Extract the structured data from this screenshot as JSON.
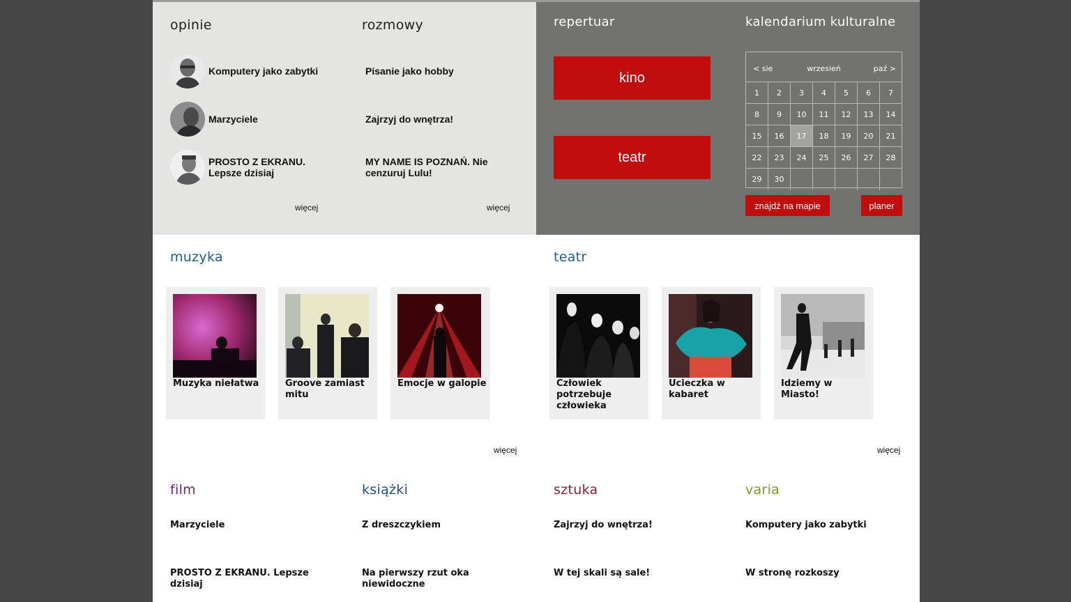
{
  "opinie": {
    "title": "opinie",
    "items": [
      {
        "label": "Komputery jako zabytki"
      },
      {
        "label": "Marzyciele"
      },
      {
        "label": "PROSTO Z EKRANU. Lepsze dzisiaj"
      }
    ],
    "more": "więcej"
  },
  "rozmowy": {
    "title": "rozmowy",
    "items": [
      {
        "label": "Pisanie jako hobby"
      },
      {
        "label": "Zajrzyj do wnętrza!"
      },
      {
        "label": "MY NAME IS POZNAŃ. Nie cenzuruj Lulu!"
      }
    ],
    "more": "więcej"
  },
  "repertuar": {
    "title": "repertuar",
    "buttons": [
      "kino",
      "teatr"
    ]
  },
  "kalendarium": {
    "title": "kalendarium kulturalne",
    "prev": "< sie",
    "month": "wrzesień",
    "next": "paź >",
    "weeks": [
      [
        "1",
        "2",
        "3",
        "4",
        "5",
        "6",
        "7"
      ],
      [
        "8",
        "9",
        "10",
        "11",
        "12",
        "13",
        "14"
      ],
      [
        "15",
        "16",
        "17",
        "18",
        "19",
        "20",
        "21"
      ],
      [
        "22",
        "23",
        "24",
        "25",
        "26",
        "27",
        "28"
      ],
      [
        "29",
        "30",
        "",
        "",
        "",
        "",
        ""
      ]
    ],
    "today": "17",
    "map_button": "znajdź na mapie",
    "planner_button": "planer"
  },
  "muzyka": {
    "title": "muzyka",
    "cards": [
      {
        "label": "Muzyka niełatwa"
      },
      {
        "label": "Groove zamiast mitu"
      },
      {
        "label": "Emocje w galopie"
      }
    ],
    "more": "więcej"
  },
  "teatr": {
    "title": "teatr",
    "cards": [
      {
        "label": "Człowiek potrzebuje człowieka"
      },
      {
        "label": "Ucieczka w kabaret"
      },
      {
        "label": "Idziemy w Miasto!"
      }
    ],
    "more": "więcej"
  },
  "film": {
    "title": "film",
    "color": "#6b2a6b",
    "items": [
      "Marzyciele",
      "PROSTO Z EKRANU. Lepsze dzisiaj"
    ]
  },
  "ksiazki": {
    "title": "książki",
    "color": "#1e4e8c",
    "items": [
      "Z dreszczykiem",
      "Na pierwszy rzut oka niewidoczne"
    ]
  },
  "sztuka": {
    "title": "sztuka",
    "color": "#8c1e3a",
    "items": [
      "Zajrzyj do wnętrza!",
      "W tej skali są sale!"
    ]
  },
  "varia": {
    "title": "varia",
    "color": "#7a9a2a",
    "items": [
      "Komputery jako zabytki",
      "W stronę rozkoszy"
    ]
  },
  "colors": {
    "accent_red": "#c20d0e",
    "section_blue": "#1e5e8c",
    "panel_gray": "#72726f",
    "panel_light": "#e4e4e2"
  }
}
